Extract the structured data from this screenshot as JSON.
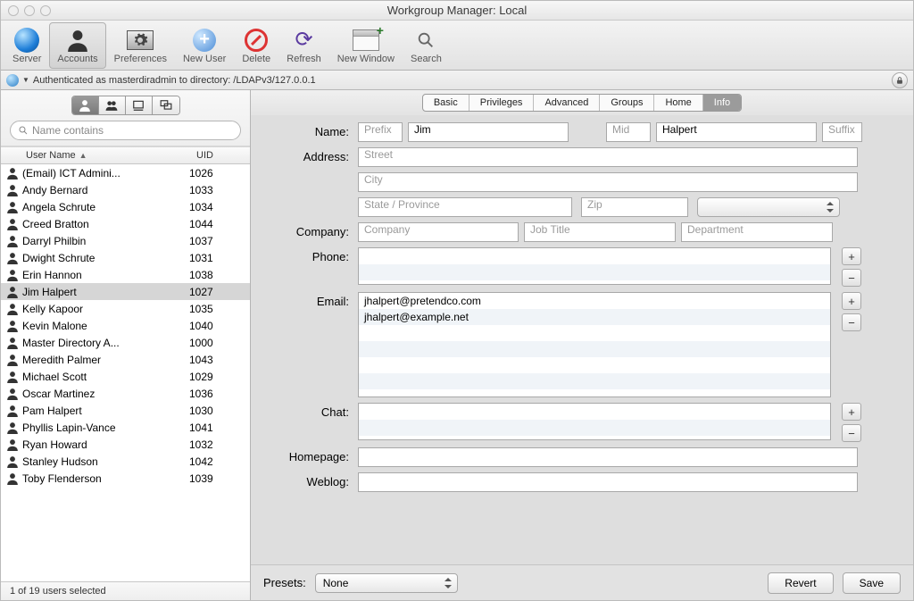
{
  "window_title": "Workgroup Manager: Local",
  "toolbar": {
    "server": "Server",
    "accounts": "Accounts",
    "preferences": "Preferences",
    "new_user": "New User",
    "delete": "Delete",
    "refresh": "Refresh",
    "new_window": "New Window",
    "search": "Search"
  },
  "auth_status": "Authenticated as masterdiradmin to directory: /LDAPv3/127.0.0.1",
  "search_placeholder": "Name contains",
  "columns": {
    "name": "User Name",
    "uid": "UID"
  },
  "users": [
    {
      "name": "(Email) ICT Admini...",
      "uid": "1026"
    },
    {
      "name": "Andy Bernard",
      "uid": "1033"
    },
    {
      "name": "Angela Schrute",
      "uid": "1034"
    },
    {
      "name": "Creed Bratton",
      "uid": "1044"
    },
    {
      "name": "Darryl Philbin",
      "uid": "1037"
    },
    {
      "name": "Dwight Schrute",
      "uid": "1031"
    },
    {
      "name": "Erin Hannon",
      "uid": "1038"
    },
    {
      "name": "Jim Halpert",
      "uid": "1027"
    },
    {
      "name": "Kelly Kapoor",
      "uid": "1035"
    },
    {
      "name": "Kevin Malone",
      "uid": "1040"
    },
    {
      "name": "Master Directory A...",
      "uid": "1000"
    },
    {
      "name": "Meredith Palmer",
      "uid": "1043"
    },
    {
      "name": "Michael Scott",
      "uid": "1029"
    },
    {
      "name": "Oscar Martinez",
      "uid": "1036"
    },
    {
      "name": "Pam Halpert",
      "uid": "1030"
    },
    {
      "name": "Phyllis Lapin-Vance",
      "uid": "1041"
    },
    {
      "name": "Ryan Howard",
      "uid": "1032"
    },
    {
      "name": "Stanley Hudson",
      "uid": "1042"
    },
    {
      "name": "Toby Flenderson",
      "uid": "1039"
    }
  ],
  "selected_user_index": 7,
  "footer_status": "1 of 19 users selected",
  "tabs": [
    "Basic",
    "Privileges",
    "Advanced",
    "Groups",
    "Home",
    "Info"
  ],
  "active_tab": 5,
  "form": {
    "labels": {
      "name": "Name:",
      "address": "Address:",
      "company": "Company:",
      "phone": "Phone:",
      "email": "Email:",
      "chat": "Chat:",
      "homepage": "Homepage:",
      "weblog": "Weblog:",
      "presets": "Presets:"
    },
    "name": {
      "prefix_ph": "Prefix",
      "first": "Jim",
      "mid_ph": "Mid",
      "last": "Halpert",
      "suffix_ph": "Suffix"
    },
    "address": {
      "street_ph": "Street",
      "city_ph": "City",
      "state_ph": "State / Province",
      "zip_ph": "Zip"
    },
    "company": {
      "comp_ph": "Company",
      "title_ph": "Job Title",
      "dept_ph": "Department"
    },
    "emails": [
      "jhalpert@pretendco.com",
      "jhalpert@example.net"
    ],
    "presets_value": "None"
  },
  "buttons": {
    "revert": "Revert",
    "save": "Save",
    "plus": "+",
    "minus": "−"
  }
}
